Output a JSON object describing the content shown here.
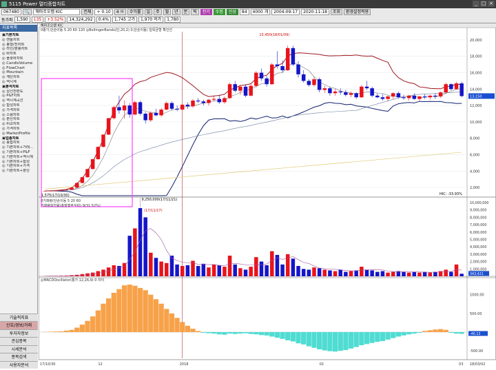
{
  "window": {
    "title_code": "5115",
    "title": "Power 멀티종합차트"
  },
  "toolbar": {
    "code": "067480",
    "name": "해마조오캠 KIC",
    "search_btn": "전체",
    "row1": [
      "+ 0.10",
      "4 ㅁ",
      "0.14%",
      "수익률",
      "일",
      "주",
      "월",
      "년",
      "분",
      "틱"
    ],
    "btn_jeonggi": "전기",
    "btn_sujeong": "수정",
    "btn_jinsang": "진상",
    "count_label": "84",
    "period_label": "4000 개",
    "date_from": "2004-09-17",
    "date_to": "2020-11-18",
    "right_btns": [
      "조회",
      "종목설정",
      "관리",
      "화면",
      "환경설정적용"
    ],
    "row2_label": "동가파",
    "row2": [
      "1,590",
      "135",
      "+3.52%",
      "14,324,292",
      "0.4%",
      "1,745 고가",
      "1,970 저가",
      "1,780"
    ]
  },
  "sidebar": {
    "header": "지표목록",
    "items": [
      {
        "t": "▣기본차트",
        "g": true
      },
      {
        "t": "◎ 캔들차트"
      },
      {
        "t": "◎ 봉형/전차트"
      },
      {
        "t": "◎ 라인/분봉차트"
      },
      {
        "t": "◎ 바차트"
      },
      {
        "t": "◎ 플롯바차트"
      },
      {
        "t": "◎ CandleVolume"
      },
      {
        "t": "◎ FlowChart"
      },
      {
        "t": "◎ Mountain"
      },
      {
        "t": "◎ 계단차트"
      },
      {
        "t": "◎ 역시계"
      },
      {
        "t": "▣분석차트",
        "g": true
      },
      {
        "t": "◎ 삼선전환도"
      },
      {
        "t": "◎ P&F차트"
      },
      {
        "t": "◎ 역시계곡선"
      },
      {
        "t": "◎ 합성차트"
      },
      {
        "t": "◎ 가격차트"
      },
      {
        "t": "◎ 스윙차트"
      },
      {
        "t": "◎ 분산차트"
      },
      {
        "t": "◎ 비교차트"
      },
      {
        "t": "◎ 가격차트"
      },
      {
        "t": "◎ MarketProfile"
      },
      {
        "t": "▣업종차트",
        "g": true
      },
      {
        "t": "◎ 종합차트"
      },
      {
        "t": "◎ 기본차트+거래..."
      },
      {
        "t": "◎ 기본차트+P&F"
      },
      {
        "t": "◎ 기본차트+역시계"
      },
      {
        "t": "◎ 기본차트+합성"
      },
      {
        "t": "◎ 기본차트+가격"
      },
      {
        "t": "◎ 기본차트+분산"
      }
    ],
    "bottom": [
      "기술적지표",
      "신호/경보/거래",
      "투자자정보",
      "관심종목",
      "시세분석",
      "종목검색",
      "사용자분석"
    ]
  },
  "price_panel": {
    "legend": "0종가,단순이동 5 20 60 120 ◎BollingerBands(단,20,2) 0,단순이동) 일목균형 확인선",
    "max_label": "15,450(18/01/09)",
    "min_label": "1,575(17/10/30)",
    "right_label": "HIC: -33.93%",
    "axis": [
      "20,000",
      "18,000",
      "16,000",
      "14,000",
      "12,000",
      "10,000",
      "8,000",
      "6,000",
      "4,000",
      "2,000"
    ],
    "last_price": "13,150",
    "name_label": "해마조오캠 KIC"
  },
  "volume_panel": {
    "legend": "0거래량(단순이동 5 20 60",
    "legend2": "거래량회전율(총발행주식비) 9(31.52%)",
    "max_label": "9,250,000(17/11/21)",
    "top_label": "(17/11/17)",
    "axis": [
      "10,000,000",
      "9,000,000",
      "8,000,000",
      "7,000,000",
      "6,000,000",
      "5,000,000",
      "4,000,000",
      "3,000,000",
      "2,000,000",
      "1,000,000"
    ],
    "last": "343,421"
  },
  "macd_panel": {
    "legend": "◎MACDOscillator(종가 12,26,9) 0 차이",
    "axis": [
      "1000.00",
      "500.00",
      "-500.00"
    ],
    "last": "-46.13"
  },
  "xaxis": [
    "17/10/30",
    "12",
    "2018",
    "02",
    "03",
    "18/03/02"
  ],
  "colors": {
    "up": "#e8141b",
    "down": "#1515c8",
    "bb": "#a01820",
    "bbl": "#10206e",
    "macd_pos": "#f7a24a",
    "macd_neg": "#4fdcd2",
    "magenta": "#ff40ff"
  },
  "chart_data": {
    "type": "candlestick",
    "candles": [
      [
        1575,
        1600,
        1575,
        1590
      ],
      [
        1590,
        1620,
        1580,
        1600
      ],
      [
        1600,
        1650,
        1590,
        1620
      ],
      [
        1620,
        1700,
        1600,
        1680
      ],
      [
        1680,
        1760,
        1650,
        1740
      ],
      [
        1740,
        2000,
        1720,
        1980
      ],
      [
        1980,
        2600,
        1950,
        2550
      ],
      [
        2550,
        3300,
        2500,
        3250
      ],
      [
        3250,
        4300,
        3200,
        4250
      ],
      [
        4250,
        5500,
        4200,
        5450
      ],
      [
        5450,
        7000,
        5400,
        6950
      ],
      [
        6950,
        8500,
        6900,
        8450
      ],
      [
        8450,
        10500,
        8400,
        10450
      ],
      [
        10450,
        12000,
        10300,
        11800
      ],
      [
        11800,
        13200,
        11000,
        11400
      ],
      [
        11400,
        12600,
        10400,
        12000
      ],
      [
        12000,
        12300,
        10500,
        10900
      ],
      [
        10900,
        12600,
        10800,
        12400
      ],
      [
        12400,
        12600,
        10800,
        11000
      ],
      [
        11000,
        11200,
        9800,
        10200
      ],
      [
        10200,
        11300,
        10000,
        11100
      ],
      [
        11100,
        11600,
        10700,
        10800
      ],
      [
        10800,
        11700,
        10600,
        11500
      ],
      [
        11500,
        12500,
        11400,
        12300
      ],
      [
        12300,
        12500,
        11400,
        11600
      ],
      [
        11600,
        12000,
        11300,
        11500
      ],
      [
        11500,
        12200,
        11400,
        12100
      ],
      [
        12100,
        12400,
        11600,
        11900
      ],
      [
        11900,
        12800,
        11700,
        12600
      ],
      [
        12600,
        12900,
        12300,
        12500
      ],
      [
        12500,
        12700,
        12000,
        12300
      ],
      [
        12300,
        12800,
        12000,
        12700
      ],
      [
        12700,
        13200,
        12500,
        12800
      ],
      [
        12800,
        13300,
        12200,
        12400
      ],
      [
        12400,
        13100,
        12200,
        12900
      ],
      [
        12900,
        14800,
        12800,
        14600
      ],
      [
        14600,
        15000,
        13600,
        13800
      ],
      [
        13800,
        14500,
        13300,
        14300
      ],
      [
        14300,
        14600,
        13000,
        13200
      ],
      [
        13200,
        14600,
        13100,
        14400
      ],
      [
        14400,
        16200,
        14200,
        16000
      ],
      [
        16000,
        16500,
        15000,
        15300
      ],
      [
        15300,
        15600,
        14300,
        14600
      ],
      [
        14600,
        17200,
        14500,
        17000
      ],
      [
        17000,
        18600,
        16500,
        16800
      ],
      [
        16800,
        17500,
        16000,
        16300
      ],
      [
        16300,
        19300,
        16200,
        19000
      ],
      [
        19000,
        19300,
        16800,
        17000
      ],
      [
        17000,
        17400,
        15400,
        15800
      ],
      [
        15800,
        16300,
        14800,
        15000
      ],
      [
        15000,
        15200,
        14300,
        14500
      ],
      [
        14500,
        15500,
        14300,
        15200
      ],
      [
        15200,
        15400,
        13600,
        13900
      ],
      [
        13900,
        14400,
        13500,
        14100
      ],
      [
        14100,
        14300,
        13200,
        13500
      ],
      [
        13500,
        14000,
        13200,
        13700
      ],
      [
        13700,
        14100,
        13300,
        13600
      ],
      [
        13600,
        13900,
        13100,
        13300
      ],
      [
        13300,
        13700,
        13000,
        13500
      ],
      [
        13500,
        13600,
        12800,
        13000
      ],
      [
        13000,
        14500,
        12900,
        14300
      ],
      [
        14300,
        15000,
        13900,
        14100
      ],
      [
        14100,
        14300,
        13000,
        13200
      ],
      [
        13200,
        13500,
        12900,
        13000
      ],
      [
        13000,
        13400,
        12600,
        12800
      ],
      [
        12800,
        13200,
        12500,
        13100
      ],
      [
        13100,
        13600,
        12800,
        13500
      ],
      [
        13500,
        13700,
        12900,
        13000
      ],
      [
        13000,
        13300,
        12700,
        12900
      ],
      [
        12900,
        13300,
        12600,
        13200
      ],
      [
        13200,
        13500,
        12700,
        12800
      ],
      [
        12800,
        13200,
        12500,
        13100
      ],
      [
        13100,
        13400,
        12800,
        13000
      ],
      [
        13000,
        13300,
        12700,
        13200
      ],
      [
        13200,
        13500,
        12800,
        13100
      ],
      [
        13100,
        13700,
        12900,
        13600
      ],
      [
        13600,
        14800,
        13400,
        14600
      ],
      [
        14600,
        14700,
        13800,
        14000
      ],
      [
        14000,
        14900,
        13900,
        14700
      ],
      [
        14700,
        14900,
        13000,
        13150
      ]
    ],
    "volume_millions": [
      0.02,
      0.05,
      0.05,
      0.08,
      0.1,
      0.15,
      0.2,
      0.3,
      0.4,
      0.5,
      0.7,
      0.9,
      1.2,
      1.5,
      1.4,
      1.8,
      5.5,
      6.5,
      9.25,
      8.0,
      3.2,
      2.5,
      2.0,
      1.8,
      2.8,
      1.6,
      1.4,
      1.5,
      2.1,
      1.4,
      1.7,
      1.2,
      1.6,
      1.5,
      1.3,
      2.8,
      1.6,
      1.1,
      0.9,
      1.3,
      2.6,
      2.0,
      1.5,
      3.4,
      2.9,
      1.6,
      3.0,
      2.4,
      1.4,
      1.0,
      0.9,
      1.2,
      1.1,
      0.9,
      0.8,
      0.7,
      0.9,
      0.6,
      0.7,
      0.8,
      1.3,
      0.9,
      0.8,
      0.6,
      0.7,
      0.5,
      0.6,
      0.7,
      0.6,
      0.5,
      0.6,
      0.5,
      0.6,
      0.5,
      0.6,
      0.7,
      0.9,
      0.6,
      1.6,
      0.35
    ],
    "macd": [
      5,
      10,
      15,
      20,
      40,
      60,
      120,
      200,
      300,
      420,
      580,
      760,
      900,
      1050,
      1150,
      1250,
      1270,
      1240,
      1180,
      1120,
      1000,
      880,
      760,
      620,
      500,
      380,
      270,
      170,
      90,
      30,
      -20,
      -30,
      -40,
      -60,
      -70,
      -40,
      -50,
      -40,
      -30,
      -50,
      -60,
      -80,
      -90,
      -120,
      -150,
      -180,
      -220,
      -250,
      -300,
      -330,
      -380,
      -420,
      -460,
      -490,
      -510,
      -520,
      -500,
      -480,
      -440,
      -400,
      -350,
      -320,
      -290,
      -260,
      -240,
      -200,
      -160,
      -120,
      -90,
      -60,
      -40,
      -20,
      30,
      50,
      70,
      80,
      60,
      -20,
      -40,
      -46
    ]
  }
}
